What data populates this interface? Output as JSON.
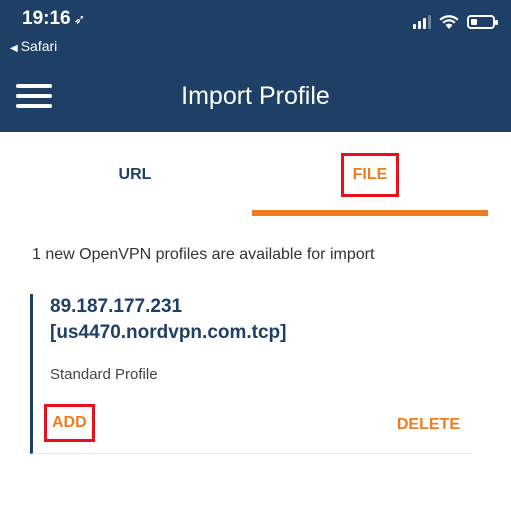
{
  "status_bar": {
    "time": "19:16",
    "location_icon": "location-arrow-icon",
    "back_app": "Safari"
  },
  "header": {
    "title": "Import Profile",
    "menu_icon": "hamburger-menu-icon",
    "background": "#1e3f66"
  },
  "tabs": [
    {
      "label": "URL",
      "active": false
    },
    {
      "label": "FILE",
      "active": true
    }
  ],
  "info_text": "1 new OpenVPN profiles are available for import",
  "profile": {
    "name_line1": "89.187.177.231",
    "name_line2": "[us4470.nordvpn.com.tcp]",
    "type": "Standard Profile",
    "add_label": "ADD",
    "delete_label": "DELETE"
  },
  "colors": {
    "accent": "#ee7d22",
    "primary": "#1e3f66",
    "highlight": "#e8101a"
  }
}
